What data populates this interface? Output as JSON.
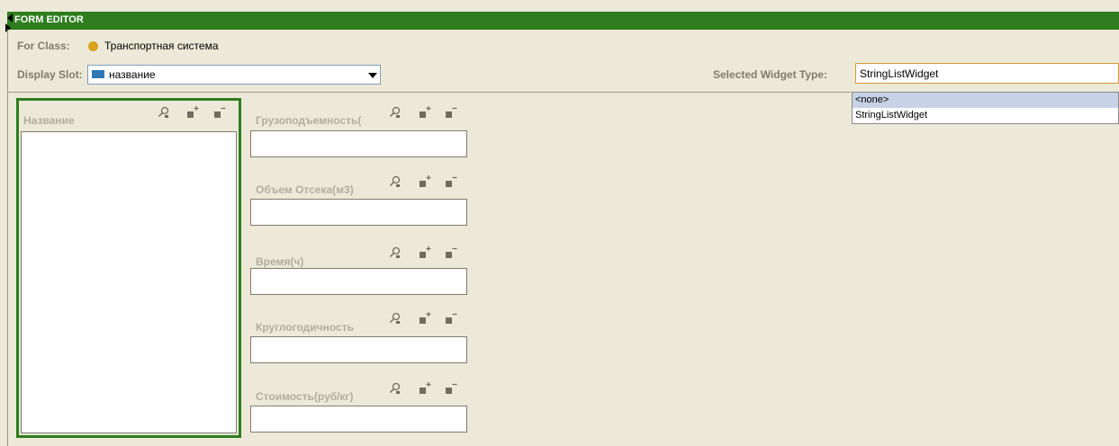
{
  "editor": {
    "title": "FORM EDITOR",
    "for_class_label": "For Class:",
    "for_class_value": "Транспортная система",
    "display_slot_label": "Display Slot:",
    "display_slot_value": "название",
    "selected_widget_label": "Selected Widget Type:",
    "selected_widget_value": "StringListWidget",
    "widget_options": [
      "<none>",
      "StringListWidget"
    ],
    "colors": {
      "title_bar": "#2e7d1f",
      "selection_border": "#2e7d1f",
      "class_dot": "#d8a21c",
      "slot_swatch": "#2f77b5"
    }
  },
  "widgets": [
    {
      "label": "Название",
      "icons": [
        "search-icon",
        "add-icon",
        "remove-icon"
      ]
    },
    {
      "label": "Грузоподъемность(",
      "icons": [
        "search-icon",
        "add-icon",
        "remove-icon"
      ]
    },
    {
      "label": "Объем Отсека(м3)",
      "icons": [
        "search-icon",
        "add-icon",
        "remove-icon"
      ]
    },
    {
      "label": "Время(ч)",
      "icons": [
        "search-icon",
        "add-icon",
        "remove-icon"
      ]
    },
    {
      "label": "Круглогодичность",
      "icons": [
        "search-icon",
        "add-icon",
        "remove-icon"
      ]
    },
    {
      "label": "Стоимость(руб/кг)",
      "icons": [
        "search-icon",
        "add-icon",
        "remove-icon"
      ]
    }
  ]
}
